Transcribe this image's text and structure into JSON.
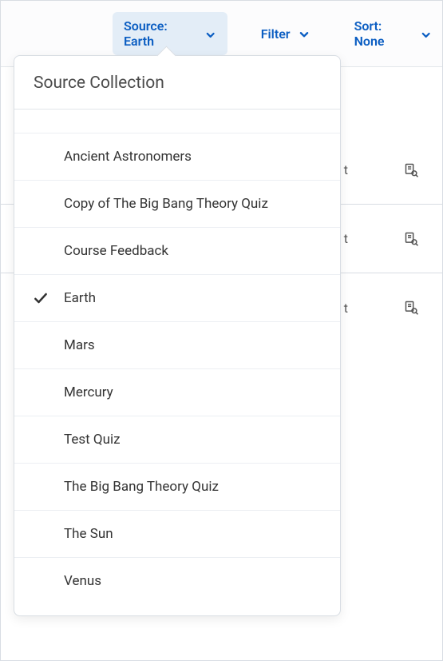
{
  "toolbar": {
    "source": {
      "label": "Source: Earth"
    },
    "filter": {
      "label": "Filter"
    },
    "sort": {
      "label": "Sort: None"
    }
  },
  "rows": {
    "r1": {
      "frag": "t"
    },
    "r2": {
      "frag": "t"
    },
    "r3": {
      "frag": "t"
    }
  },
  "dropdown": {
    "title": "Source Collection",
    "items": [
      {
        "label": "Ancient Astronomers",
        "selected": false
      },
      {
        "label": "Copy of The Big Bang Theory Quiz",
        "selected": false
      },
      {
        "label": "Course Feedback",
        "selected": false
      },
      {
        "label": "Earth",
        "selected": true
      },
      {
        "label": "Mars",
        "selected": false
      },
      {
        "label": "Mercury",
        "selected": false
      },
      {
        "label": "Test Quiz",
        "selected": false
      },
      {
        "label": "The Big Bang Theory Quiz",
        "selected": false
      },
      {
        "label": "The Sun",
        "selected": false
      },
      {
        "label": "Venus",
        "selected": false
      }
    ]
  },
  "colors": {
    "accent": "#0a5dc2"
  }
}
